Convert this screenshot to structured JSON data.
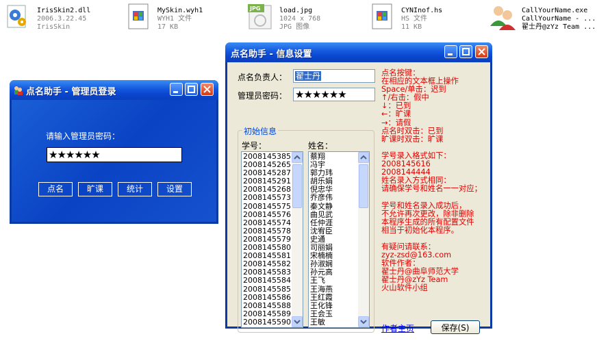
{
  "desktop_files": [
    {
      "name": "IrisSkin2.dll",
      "line2": "2006.3.22.45",
      "line3": "IrisSkin",
      "icon": "dll-gear-icon"
    },
    {
      "name": "MySkin.wyh1",
      "line2": "WYH1 文件",
      "line3": "17 KB",
      "icon": "document-icon"
    },
    {
      "name": "load.jpg",
      "line2": "1024 x 768",
      "line3": "JPG 图像",
      "icon": "jpg-image-icon"
    },
    {
      "name": "CYNInof.hs",
      "line2": "HS 文件",
      "line3": "11 KB",
      "icon": "document-icon"
    },
    {
      "name": "CallYourName.exe",
      "line2": "CallYourName - ...",
      "line3": "翟士丹@zYz Team ...",
      "icon": "users-icon"
    }
  ],
  "login_window": {
    "title": "点名助手 - 管理员登录",
    "prompt": "请输入管理员密码：",
    "password_value": "★★★★★★",
    "buttons": [
      "点名",
      "旷课",
      "统计",
      "设置"
    ]
  },
  "settings_window": {
    "title": "点名助手 - 信息设置",
    "manager_label": "点名负责人：",
    "manager_value": "翟士丹",
    "password_label": "管理员密码：",
    "password_value": "★★★★★★",
    "group_title": "初始信息",
    "id_header": "学号：",
    "name_header": "姓名：",
    "ids": [
      "2008145385",
      "2008145265",
      "2008145287",
      "2008145291",
      "2008145268",
      "2008145573",
      "2008145575",
      "2008145576",
      "2008145574",
      "2008145578",
      "2008145579",
      "2008145580",
      "2008145581",
      "2008145582",
      "2008145583",
      "2008145584",
      "2008145585",
      "2008145586",
      "2008145588",
      "2008145589",
      "2008145590"
    ],
    "names": [
      "蔡翔",
      "冯宇",
      "郭力玮",
      "胡乐娟",
      "倪忠华",
      "乔彦伟",
      "秦文静",
      "曲见武",
      "任仲涯",
      "沈宥臣",
      "史通",
      "司丽娟",
      "宋楠楠",
      "孙淑娴",
      "孙元高",
      "王飞",
      "王海燕",
      "王红霞",
      "王化锋",
      "王会玉",
      "王敏"
    ],
    "info_text": "点名按键：\n在相应的文本框上操作\nSpace/单击：迟到\n↑/右击：假中\n↓：已到\n←：旷课\n→：请假\n点名时双击：已到\n旷课时双击：旷课\n\n学号录入格式如下：\n2008145616\n2008144444\n姓名录入方式相同：\n请确保学号和姓名一一对应；\n\n学号和姓名录入成功后，\n不允许再次更改，除非删除\n本程序生成的所有配置文件\n相当于初始化本程序。\n\n有疑问请联系：\nzyz-zsd@163.com\n软件作者：\n翟士丹@曲阜师范大学\n翟士丹@zYz Team\n火山软件小组",
    "homepage_link": "作者主页",
    "save_button": "保存(S)"
  },
  "colors": {
    "info_text": "#e00000",
    "link": "#0000ee",
    "title_bar": "#0a46d0"
  }
}
